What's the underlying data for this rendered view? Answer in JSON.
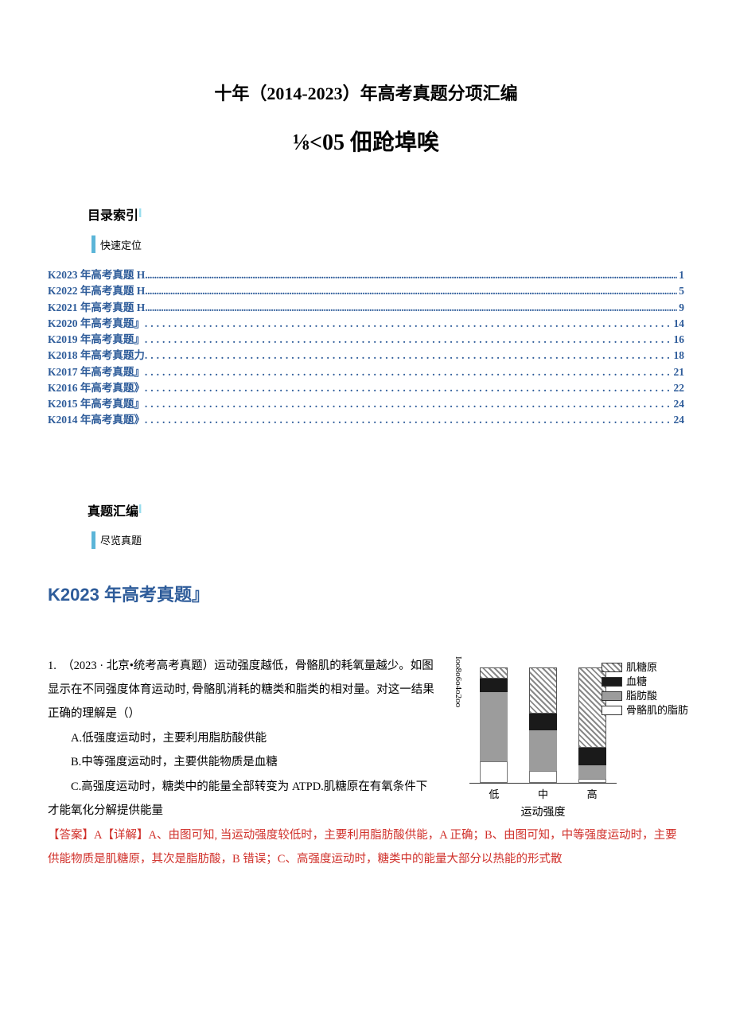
{
  "main_title": "十年（2014-2023）年高考真题分项汇编",
  "sub_title": "⅛<05 佃跄埠唉",
  "toc_header": {
    "title": "目录索引",
    "marker": "I",
    "sub": "快速定位"
  },
  "toc": [
    {
      "label": "K2023 年高考真题 H",
      "dots_class": "toc-dots-1",
      "page": "1"
    },
    {
      "label": "K2022 年高考真题 H",
      "dots_class": "toc-dots-1",
      "page": "5"
    },
    {
      "label": "K2021 年高考真题 H",
      "dots_class": "toc-dots-1",
      "page": "9"
    },
    {
      "label": "K2020 年高考真题』",
      "dots_class": "toc-dots-2",
      "page": "14"
    },
    {
      "label": "K2019 年高考真题』",
      "dots_class": "toc-dots-2",
      "page": "16"
    },
    {
      "label": "K2018 年高考真题力",
      "dots_class": "toc-dots-2",
      "page": "18"
    },
    {
      "label": "K2017 年高考真题』",
      "dots_class": "toc-dots-2",
      "page": "21"
    },
    {
      "label": "K2016 年高考真题》",
      "dots_class": "toc-dots-2",
      "page": "22"
    },
    {
      "label": "K2015 年高考真题』",
      "dots_class": "toc-dots-2",
      "page": "24"
    },
    {
      "label": "K2014 年高考真题》",
      "dots_class": "toc-dots-2",
      "page": "24"
    }
  ],
  "compile_header": {
    "title": "真题汇编",
    "marker": "I",
    "sub": "尽览真题"
  },
  "section_heading": "K2023 年高考真题』",
  "question": {
    "intro": "1.　（2023 · 北京•统考高考真题）运动强度越低，骨骼肌的耗氧量越少。如图显示在不同强度体育运动时, 骨骼肌消耗的糖类和脂类的相对量。对这一结果正确的理解是（）",
    "optA": "A.低强度运动时，主要利用脂肪酸供能",
    "optB": "B.中等强度运动时，主要供能物质是血糖",
    "optC": "C.高强度运动时，糖类中的能量全部转变为 ATPD.肌糖原在有氧条件下才能氧化分解提供能量",
    "answer_prefix": "【答案】A【详解】",
    "answer_body": "A、由图可知, 当运动强度较低时，主要利用脂肪酸供能，A 正确；B、由图可知，中等强度运动时，主要供能物质是肌糖原，其次是脂肪酸，B 错误；C、高强度运动时，糖类中的能量大部分以热能的形式散"
  },
  "chart_data": {
    "type": "bar",
    "y_axis_label": "Ioo8o6o4o2oo",
    "legend": [
      {
        "name": "肌糖原",
        "swatch": "sw-hatch"
      },
      {
        "name": "血糖",
        "swatch": "sw-black"
      },
      {
        "name": "脂肪酸",
        "swatch": "sw-gray"
      },
      {
        "name": "骨骼肌的脂肪",
        "swatch": "sw-white"
      }
    ],
    "categories": [
      "低",
      "中",
      "高"
    ],
    "series": [
      {
        "name": "肌糖原",
        "values": [
          10,
          40,
          70
        ]
      },
      {
        "name": "血糖",
        "values": [
          12,
          15,
          15
        ]
      },
      {
        "name": "脂肪酸",
        "values": [
          60,
          35,
          12
        ]
      },
      {
        "name": "骨骼肌的脂肪",
        "values": [
          18,
          10,
          3
        ]
      }
    ],
    "xlabel": "运动强度"
  }
}
